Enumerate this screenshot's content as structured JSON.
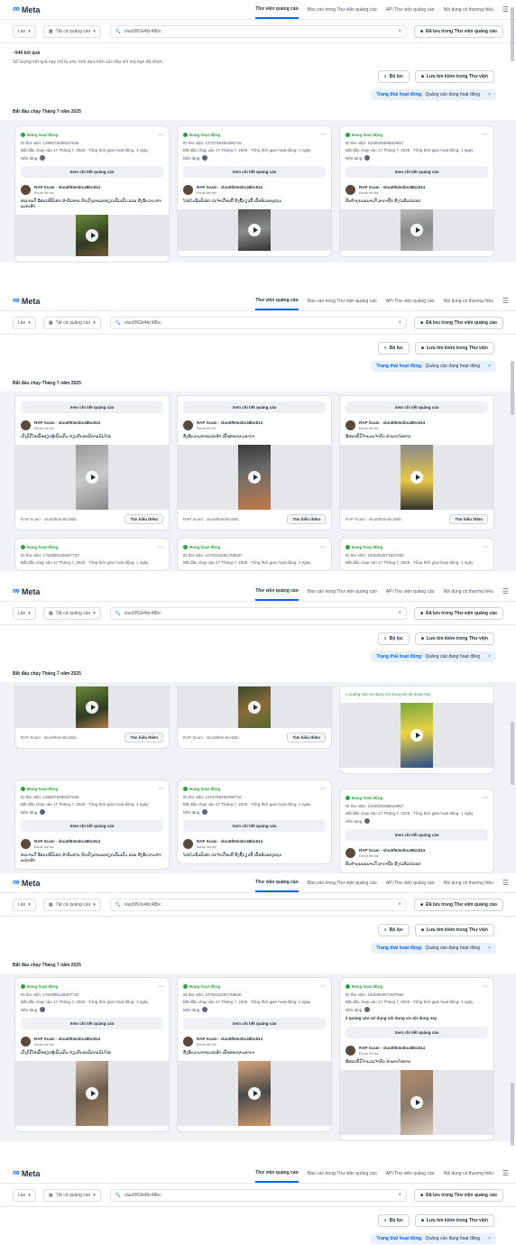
{
  "header": {
    "logo_text": "Meta",
    "tabs": [
      "Thư viện quảng cáo",
      "Báo cáo trong Thư viện quảng cáo",
      "API Thư viện quảng cáo",
      "Nội dung có thương hiệu"
    ],
    "active_tab": 0
  },
  "filters": {
    "country": "Lào",
    "category": "Tất cả quảng cáo",
    "search_value": "sluu5f63e4bc48bc",
    "save_label": "Đã lưu trong Thư viện quảng cáo"
  },
  "results": {
    "count": "~940 kết quả",
    "description": "Số lượng kết quả này chỉ là ước tính dựa trên các tiêu chí mà bạn đã chọn.",
    "filter_button": "Bộ lọc",
    "save_search_button": "Lưu tìm kiếm trong Thư viện",
    "active_filter_label": "Trạng thái hoạt động:",
    "active_filter_value": "Quảng cáo đang hoạt động",
    "date_heading": "Bắt đầu chạy Tháng 7 năm 2025"
  },
  "card": {
    "status": "Đang hoạt động",
    "lib_id_prefix": "ID thư viện:",
    "started": "Bắt đầu chạy vào 17 Tháng 7, 2025 · Tổng thời gian hoạt động: 1 ngày",
    "platforms": "Nền tảng",
    "details_button": "Xem chi tiết quảng cáo",
    "advertiser": "RAP Scam · sluu5f63e4bc48bc814",
    "sponsored": "Được tài trợ",
    "cta_button": "Tìm hiểu thêm",
    "site": "RAP Scam · sluu5f63e4bc48bc",
    "multi_version": "2 quảng cáo sử dụng nội dung và nội dung này"
  },
  "cards": [
    {
      "id": "1396078498327645",
      "copy": "ສະບາຍດີ ຂໍ້ສະເໜີພິເສດ ສຳລັບທ່ານ ກົດເບິ່ງລາຍລະອຽດເພີ່ມເຕີມ ແລະ ສົ່ງຂໍ້ຄວາມຫາພວກເຮົາ"
    },
    {
      "id": "1372769482395715",
      "copy": "ໂປຣໂມຊັ່ນພິເສດ ປະຈຳເດືອນນີ້ ສັ່ງຊື້ດຽວນີ້ ເພື່ອຮັບຂອງແຖມ"
    },
    {
      "id": "1193028496523657",
      "copy": "ສິນຄ້າຄຸນນະພາບດີ ລາຄາຖືກ ສົ່ງໄວທົ່ວປະເທດ"
    },
    {
      "id": "1762990138407720",
      "copy": "ເບິ່ງວິດີໂອເພື່ອຮຽນຮູ້ເພີ່ມເຕີມ ກ່ຽວກັບຜະລິດຕະພັນໃໝ່"
    },
    {
      "id": "1078416291748840",
      "copy": "ສົ່ງຂໍ້ຄວາມຫາພວກເຮົາ ເພື່ອສອບຖາມລາຄາ"
    },
    {
      "id": "1840292871937664",
      "copy": "ຂໍ້ສະເໜີມີຈຳນວນຈຳກັດ ຢ່າພາດໂອກາດ"
    }
  ]
}
